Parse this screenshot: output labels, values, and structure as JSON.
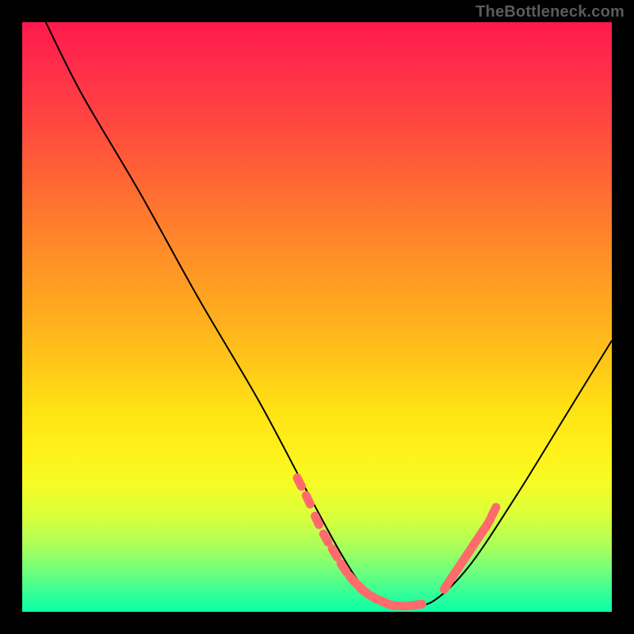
{
  "watermark": "TheBottleneck.com",
  "chart_data": {
    "type": "line",
    "title": "",
    "xlabel": "",
    "ylabel": "",
    "xlim": [
      0,
      100
    ],
    "ylim": [
      0,
      100
    ],
    "grid": false,
    "legend": false,
    "background_gradient": {
      "top": "#ff1a4d",
      "mid": "#ffe314",
      "bottom": "#0affa5"
    },
    "series": [
      {
        "name": "bottleneck-curve",
        "color": "#000000",
        "x": [
          4,
          10,
          20,
          30,
          40,
          48,
          54,
          58,
          62,
          66,
          70,
          76,
          84,
          92,
          100
        ],
        "y": [
          100,
          88,
          71,
          53,
          36,
          21,
          10,
          4,
          1,
          1,
          2,
          8,
          20,
          33,
          46
        ]
      },
      {
        "name": "left-highlight-dots",
        "color": "#ff6b6b",
        "type": "scatter",
        "x": [
          47,
          48.5,
          50,
          51.5,
          53,
          54.5,
          56,
          57.5,
          58.0,
          59.5,
          61,
          62.5,
          64,
          65.5,
          67
        ],
        "y": [
          22,
          19,
          15.5,
          12.5,
          10,
          7.5,
          5.5,
          4,
          3.5,
          2.5,
          1.8,
          1.2,
          1.0,
          1.0,
          1.2
        ]
      },
      {
        "name": "right-highlight-dots",
        "color": "#ff6b6b",
        "type": "scatter",
        "x": [
          72,
          73,
          74,
          75,
          76,
          77,
          78,
          79,
          80
        ],
        "y": [
          4.5,
          6,
          7.5,
          9,
          10.5,
          12,
          13.5,
          15,
          17
        ]
      }
    ]
  }
}
